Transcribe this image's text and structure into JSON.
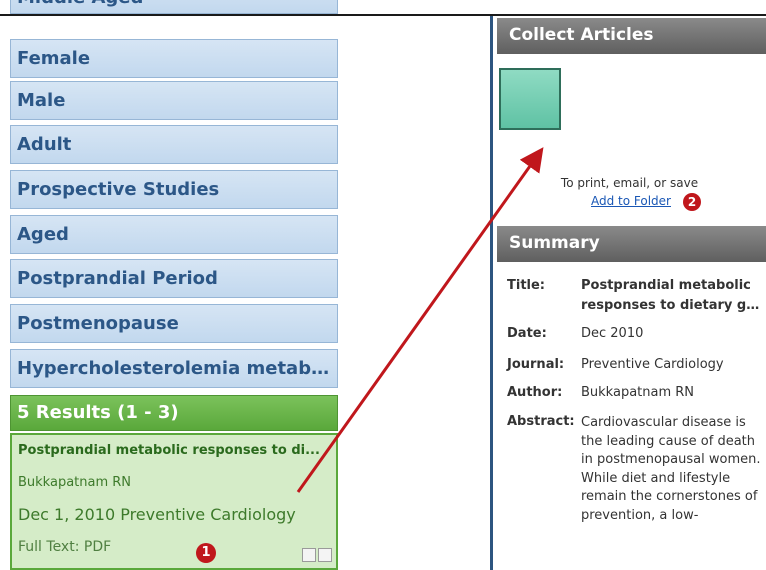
{
  "facets": {
    "partial_top": "Middle Aged",
    "items": [
      "Female",
      "Male",
      "Adult",
      "Prospective Studies",
      "Aged",
      "Postprandial Period",
      "Postmenopause",
      "Hypercholesterolemia metaboli..."
    ]
  },
  "results": {
    "header": "5 Results (1 - 3)",
    "first": {
      "title": "Postprandial metabolic responses to di...",
      "author": "Bukkapatnam RN",
      "date_source": "Dec 1, 2010 Preventive Cardiology",
      "full_text": "Full Text: PDF"
    }
  },
  "badges": {
    "one": "1",
    "two": "2"
  },
  "collect": {
    "header": "Collect Articles",
    "instruction": "To print, email, or save",
    "link": "Add to Folder"
  },
  "summary": {
    "header": "Summary",
    "title_label": "Title:",
    "title_line1": "Postprandial metabolic",
    "title_line2": "responses to dietary g...",
    "date_label": "Date:",
    "date": "Dec 2010",
    "journal_label": "Journal:",
    "journal": "Preventive Cardiology",
    "author_label": "Author:",
    "author": "Bukkapatnam RN",
    "abstract_label": "Abstract:",
    "abstract": "Cardiovascular disease is the leading cause of death in postmenopausal women. While diet and lifestyle remain the cornerstones of prevention, a low-"
  },
  "colors": {
    "facet_text": "#2c5787",
    "results_green": "#5aa83b",
    "arrow": "#c0171c",
    "badge": "#c0171c"
  },
  "icons": {
    "result_actions": [
      "square-icon",
      "square-icon"
    ],
    "folder": "folder-thumbnail"
  }
}
